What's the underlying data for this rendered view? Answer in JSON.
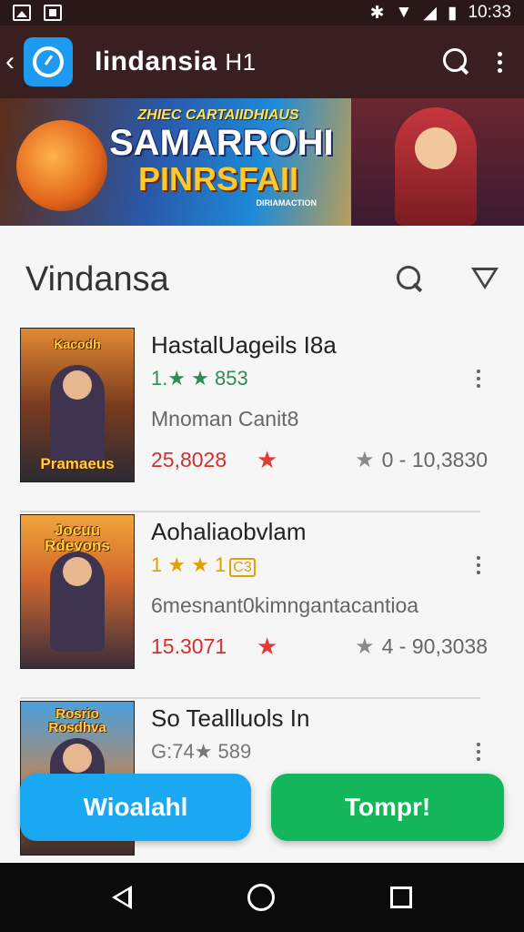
{
  "status_bar": {
    "time": "10:33"
  },
  "app_bar": {
    "title": "Iindansia",
    "title_suffix": "H1"
  },
  "banner": {
    "kicker": "ZHIEC CARTAIIDHIAUS",
    "line1": "SAMARROHI",
    "line2": "PINRSFAII",
    "tag": "DIRIAMACTION"
  },
  "section": {
    "title": "Vindansa"
  },
  "games": [
    {
      "title": "HastalUageils I8a",
      "rating": "1.★ ★ 853",
      "subtitle": "Mnoman Canit8",
      "count": "25,8028",
      "range": "0 - 10,3830",
      "thumb_label": "Kacodh",
      "thumb_label2": "Pramaeus"
    },
    {
      "title": "Aohaliaobvlam",
      "rating": "1 ★ ★ 1",
      "rating_badge": "C3",
      "subtitle": "6mesnant0kimngantacantioa",
      "count": "15.3071",
      "range": "4 - 90,3038",
      "thumb_label": "Jocuu Rdevons"
    },
    {
      "title": "So Teallluols In",
      "rating": "G:74★ 589",
      "subtitle": "",
      "thumb_label": "Rosrio Rosdhva"
    }
  ],
  "buttons": {
    "left": "Wioalahl",
    "right": "Tompr!"
  },
  "colors": {
    "app_bar": "#3a1f20",
    "primary_blue": "#1aa8f2",
    "primary_green": "#13b65b",
    "count_red": "#d32f2f"
  }
}
